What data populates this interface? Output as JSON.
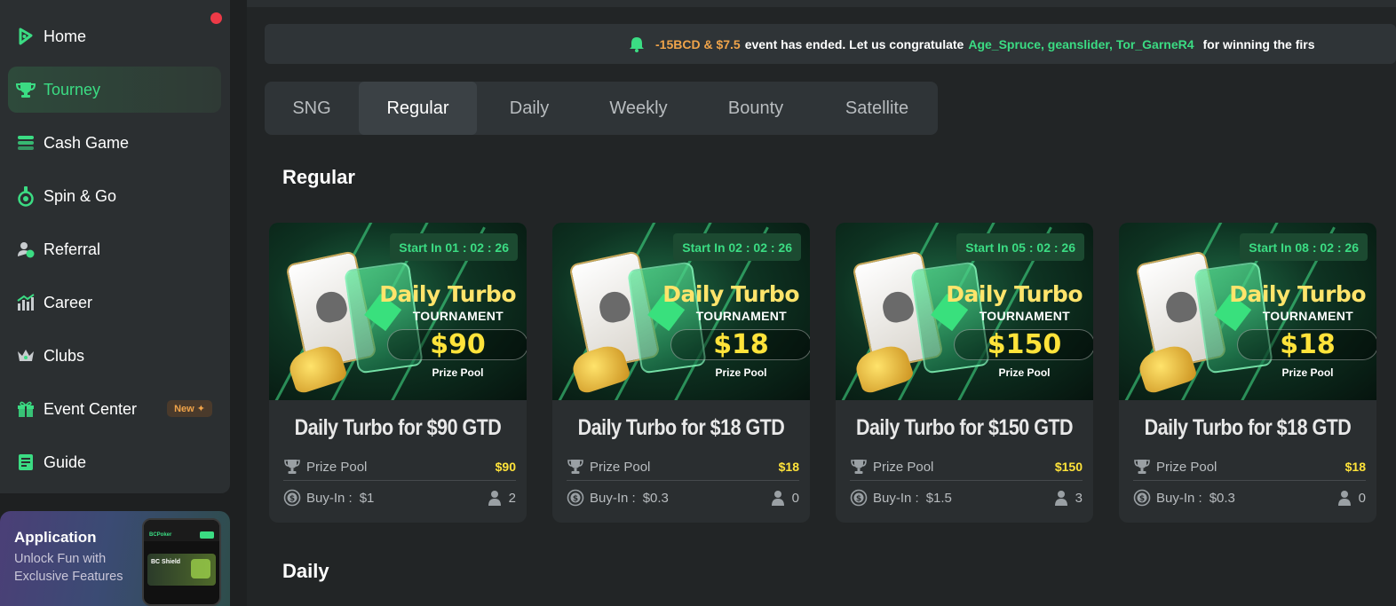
{
  "sidebar": {
    "items": [
      {
        "label": "Home",
        "icon": "home-icon"
      },
      {
        "label": "Tourney",
        "icon": "trophy-icon",
        "active": true
      },
      {
        "label": "Cash Game",
        "icon": "chips-icon"
      },
      {
        "label": "Spin & Go",
        "icon": "spin-icon"
      },
      {
        "label": "Referral",
        "icon": "referral-icon"
      },
      {
        "label": "Career",
        "icon": "career-icon"
      },
      {
        "label": "Clubs",
        "icon": "crown-icon"
      },
      {
        "label": "Event Center",
        "icon": "gift-icon",
        "badge": "New ✦"
      },
      {
        "label": "Guide",
        "icon": "guide-icon"
      }
    ]
  },
  "app_promo": {
    "title": "Application",
    "subtitle": "Unlock Fun with Exclusive Features",
    "phone_logo": "BCPoker",
    "phone_banner": "BC Shield"
  },
  "announcement": {
    "amount": "-15BCD & $7.5",
    "text1": "event has ended. Let us congratulate",
    "winners": "Age_Spruce, geanslider, Tor_GarneR4",
    "text2": "for winning the firs"
  },
  "tabs": [
    {
      "label": "SNG",
      "active": false
    },
    {
      "label": "Regular",
      "active": true
    },
    {
      "label": "Daily",
      "active": false
    },
    {
      "label": "Weekly",
      "active": false
    },
    {
      "label": "Bounty",
      "active": false
    },
    {
      "label": "Satellite",
      "active": false
    }
  ],
  "sections": {
    "regular": "Regular",
    "daily": "Daily"
  },
  "cards": [
    {
      "start": "Start In 01 : 02 : 26",
      "banner_title": "Daily Turbo",
      "banner_sub": "TOURNAMENT",
      "banner_pool": "$90",
      "banner_pool_label": "Prize Pool",
      "name": "Daily Turbo for $90 GTD",
      "prize_label": "Prize Pool",
      "prize": "$90",
      "buyin_label": "Buy-In :",
      "buyin": "$1",
      "players": "2"
    },
    {
      "start": "Start In 02 : 02 : 26",
      "banner_title": "Daily Turbo",
      "banner_sub": "TOURNAMENT",
      "banner_pool": "$18",
      "banner_pool_label": "Prize Pool",
      "name": "Daily Turbo for $18 GTD",
      "prize_label": "Prize Pool",
      "prize": "$18",
      "buyin_label": "Buy-In :",
      "buyin": "$0.3",
      "players": "0"
    },
    {
      "start": "Start In 05 : 02 : 26",
      "banner_title": "Daily Turbo",
      "banner_sub": "TOURNAMENT",
      "banner_pool": "$150",
      "banner_pool_label": "Prize Pool",
      "name": "Daily Turbo for $150 GTD",
      "prize_label": "Prize Pool",
      "prize": "$150",
      "buyin_label": "Buy-In :",
      "buyin": "$1.5",
      "players": "3"
    },
    {
      "start": "Start In 08 : 02 : 26",
      "banner_title": "Daily Turbo",
      "banner_sub": "TOURNAMENT",
      "banner_pool": "$18",
      "banner_pool_label": "Prize Pool",
      "name": "Daily Turbo for $18 GTD",
      "prize_label": "Prize Pool",
      "prize": "$18",
      "buyin_label": "Buy-In :",
      "buyin": "$0.3",
      "players": "0"
    }
  ],
  "colors": {
    "accent_green": "#3bdc83",
    "gold": "#ffe33a",
    "orange": "#f0a44a",
    "notification_red": "#ed3a47"
  }
}
